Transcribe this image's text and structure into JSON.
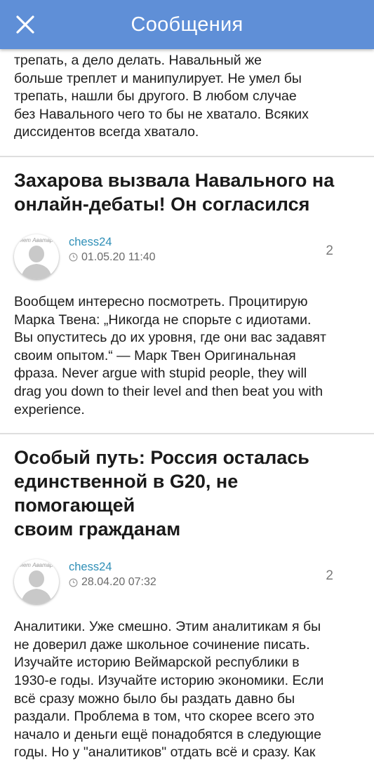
{
  "header": {
    "title": "Сообщения",
    "close_icon": "close-icon",
    "bg_color": "#5f8fd7"
  },
  "top_fragment": {
    "lines": [
      "трепать, а дело делать. Навальный же",
      "больше треплет и манипулирует. Не умел бы",
      "трепать, нашли бы другого. В любом случае",
      "без Навального чего то бы не хватало. Всяких",
      "диссидентов всегда хватало."
    ]
  },
  "posts": [
    {
      "title_lines": [
        "Захарова вызвала Навального на",
        "онлайн-дебаты! Он согласился"
      ],
      "avatar_caption": "нет Аватар",
      "author": "chess24",
      "date": "01.05.20 11:40",
      "count": "2",
      "body_lines": [
        "Вообщем интересно посмотреть.  Процитирую",
        "Марка Твена:  „Никогда не спорьте с идиотами.",
        "Вы опуститесь до их уровня, где они вас задавят",
        "своим опытом.“  — Марк Твен Оригинальная",
        "фраза. Never argue with stupid people, they will",
        "drag you down to their level and then beat you with",
        "experience."
      ]
    },
    {
      "title_lines": [
        "Особый путь: Россия осталась",
        "единственной в G20, не помогающей",
        "своим гражданам"
      ],
      "avatar_caption": "нет Аватар",
      "author": "chess24",
      "date": "28.04.20 07:32",
      "count": "2",
      "body_lines": [
        "Аналитики. Уже смешно. Этим аналитикам я бы",
        "не доверил даже школьное сочинение писать.",
        "Изучайте историю Веймарской республики в",
        "1930-е годы. Изучайте историю экономики. Если",
        "всё сразу можно было бы раздать давно бы",
        "раздали. Проблема в том, что скорее всего это",
        "начало и деньги ещё понадобятся в следующие",
        "годы. Но у \"аналитиков\" отдать всё и сразу. Как"
      ]
    }
  ]
}
